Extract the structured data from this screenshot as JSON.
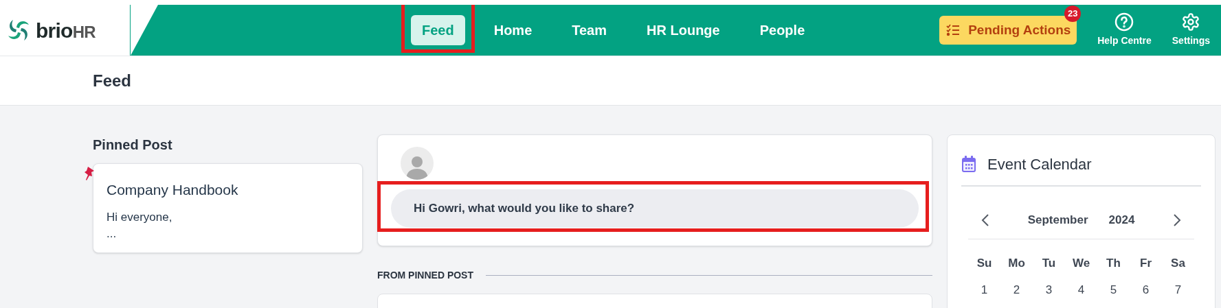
{
  "brand": {
    "name": "brio",
    "suffix": "HR"
  },
  "nav": [
    {
      "label": "Feed",
      "selected": true,
      "highlighted": true
    },
    {
      "label": "Home",
      "selected": false,
      "highlighted": false
    },
    {
      "label": "Team",
      "selected": false,
      "highlighted": false
    },
    {
      "label": "HR Lounge",
      "selected": false,
      "highlighted": false
    },
    {
      "label": "People",
      "selected": false,
      "highlighted": false
    }
  ],
  "pending_actions": {
    "label": "Pending Actions",
    "count": "23"
  },
  "header_actions": [
    {
      "kind": "help",
      "label": "Help Centre"
    },
    {
      "kind": "settings",
      "label": "Settings"
    }
  ],
  "page_title": "Feed",
  "pinned": {
    "heading": "Pinned Post",
    "title": "Company Handbook",
    "lines": [
      "Hi everyone,",
      "..."
    ]
  },
  "composer": {
    "placeholder": "Hi Gowri, what would you like to share?",
    "highlighted": true
  },
  "section_heading": "FROM PINNED POST",
  "calendar": {
    "title": "Event Calendar",
    "month": "September",
    "year": "2024",
    "weekdays": [
      "Su",
      "Mo",
      "Tu",
      "We",
      "Th",
      "Fr",
      "Sa"
    ],
    "days": [
      "1",
      "2",
      "3",
      "4",
      "5",
      "6",
      "7"
    ]
  }
}
